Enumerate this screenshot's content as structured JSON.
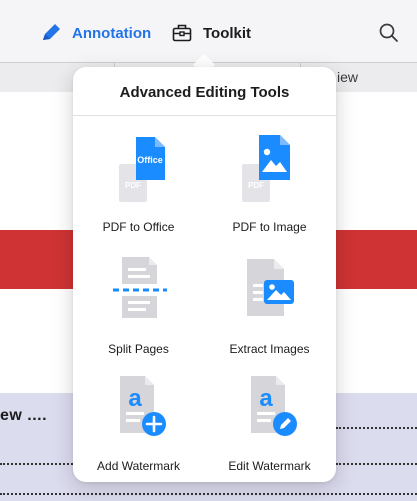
{
  "topbar": {
    "annotation_label": "Annotation",
    "toolkit_label": "Toolkit",
    "accent_color": "#2374e8"
  },
  "background": {
    "tab_partial_label": "iew",
    "row_partial_label": "ew ...."
  },
  "popover": {
    "title": "Advanced Editing Tools",
    "tools": [
      {
        "label": "PDF to Office",
        "icon": "pdf-to-office-icon",
        "badge_text": "Office",
        "ghost_text": "PDF"
      },
      {
        "label": "PDF to Image",
        "icon": "pdf-to-image-icon",
        "ghost_text": "PDF"
      },
      {
        "label": "Split Pages",
        "icon": "split-pages-icon"
      },
      {
        "label": "Extract Images",
        "icon": "extract-images-icon"
      },
      {
        "label": "Add Watermark",
        "icon": "add-watermark-icon",
        "glyph_letter": "a"
      },
      {
        "label": "Edit Watermark",
        "icon": "edit-watermark-icon",
        "glyph_letter": "a"
      }
    ]
  },
  "colors": {
    "icon_blue": "#1a8cff",
    "icon_gray": "#d6d6da",
    "icon_gray_light": "#e4e4e8",
    "band_red": "#cf3333"
  }
}
